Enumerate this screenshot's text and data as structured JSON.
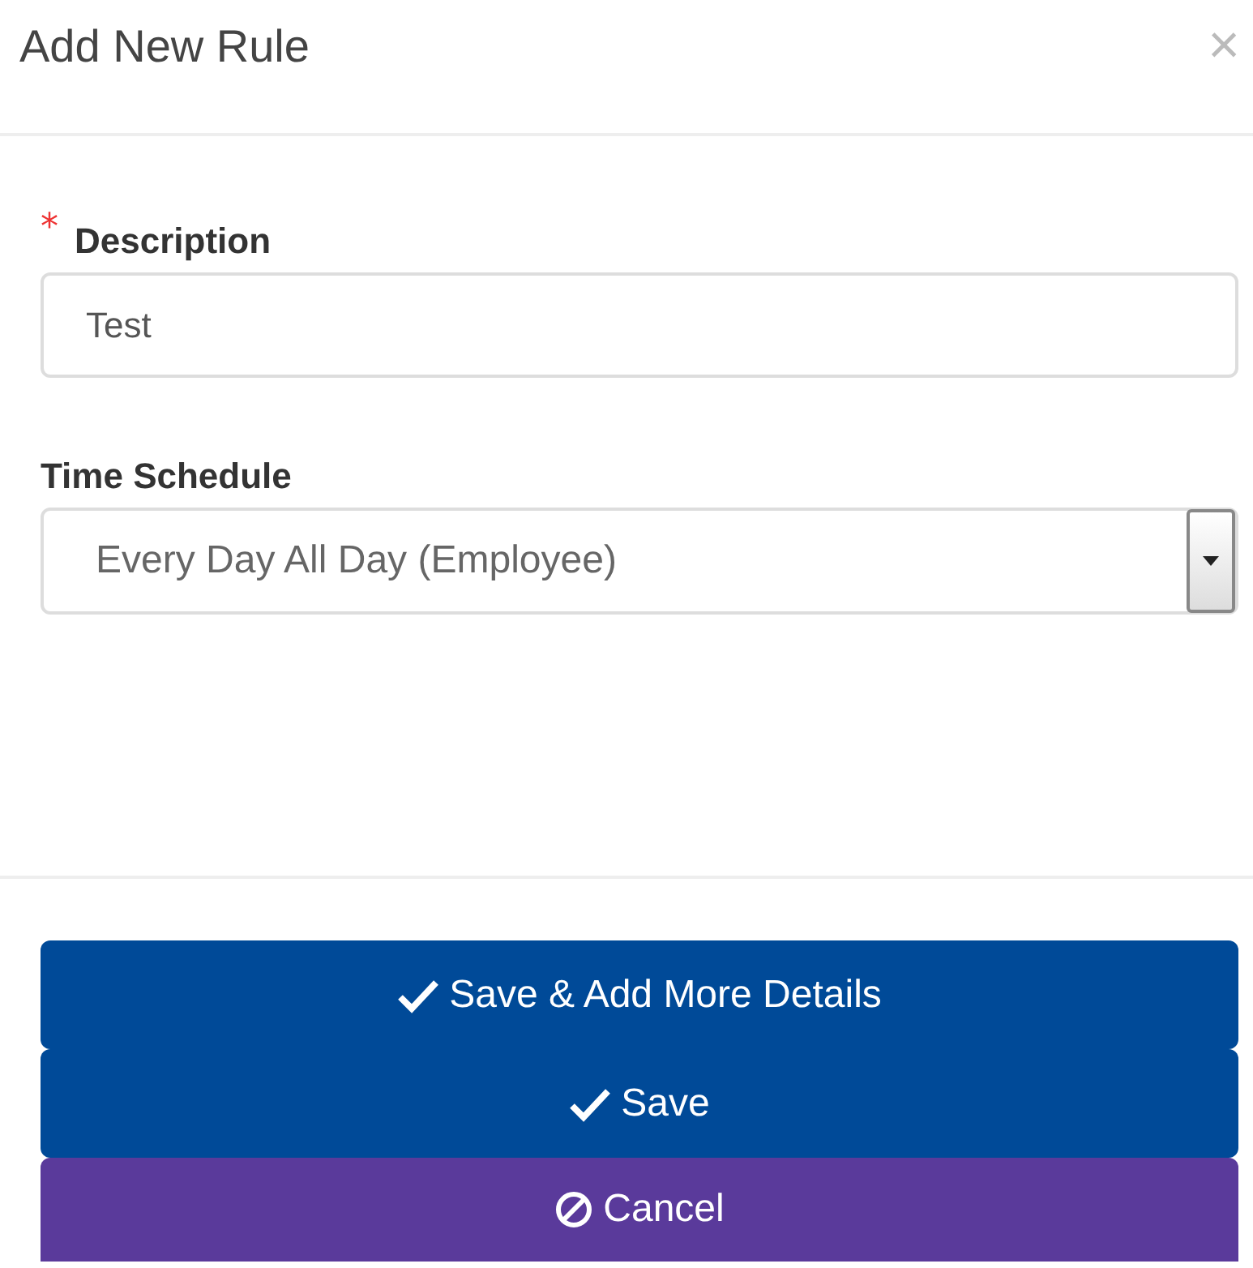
{
  "dialog": {
    "title": "Add New Rule",
    "close": "×"
  },
  "fields": [
    {
      "kind": "text",
      "required_mark": "*",
      "label": "Description",
      "value": "Test"
    },
    {
      "kind": "select",
      "label": "Time Schedule",
      "value": "Every Day All Day (Employee)"
    }
  ],
  "buttons": [
    {
      "label": "Save & Add More Details",
      "kind": "primary"
    },
    {
      "label": "Save",
      "kind": "primary"
    },
    {
      "label": "Cancel",
      "kind": "cancel"
    }
  ]
}
